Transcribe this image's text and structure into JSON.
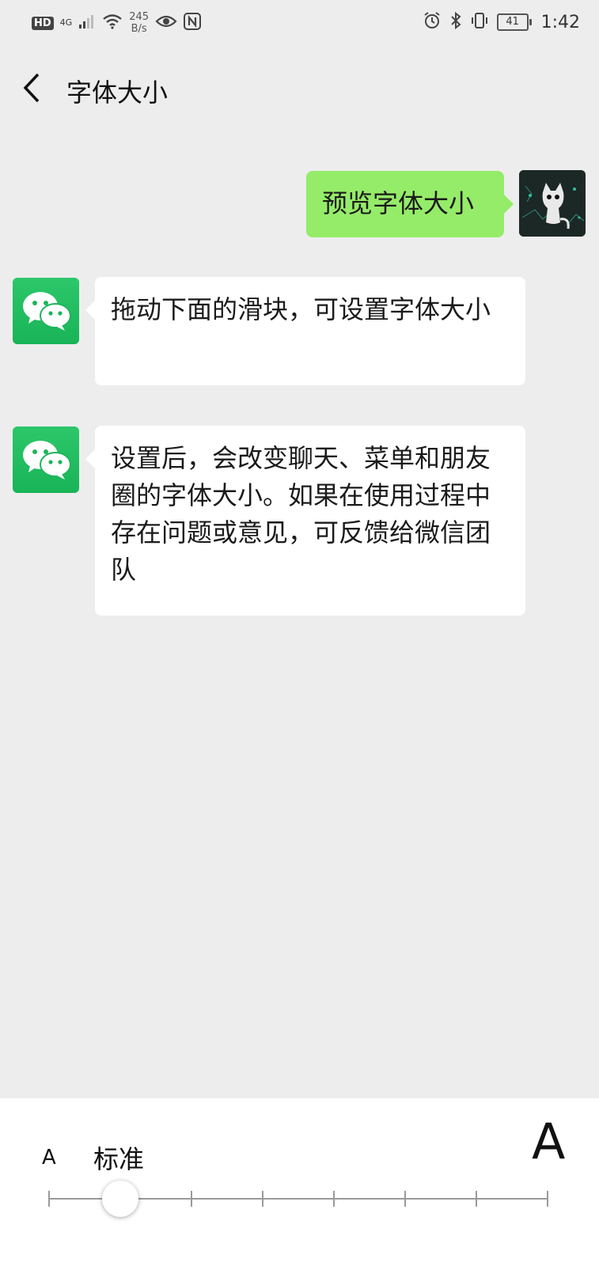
{
  "status_bar": {
    "hd": "HD",
    "network": "4G",
    "speed_value": "245",
    "speed_unit": "B/s",
    "battery": "41",
    "time": "1:42"
  },
  "header": {
    "title": "字体大小",
    "back_icon": "chevron-left-icon"
  },
  "messages": [
    {
      "side": "right",
      "text": "预览字体大小"
    },
    {
      "side": "left",
      "text": "拖动下面的滑块，可设置字体大小"
    },
    {
      "side": "left",
      "text": "设置后，会改变聊天、菜单和朋友圈的字体大小。如果在使用过程中存在问题或意见，可反馈给微信团队"
    }
  ],
  "font_size_panel": {
    "small_a": "A",
    "current_label": "标准",
    "large_a": "A",
    "slider": {
      "steps": 8,
      "selected_index": 1
    }
  },
  "colors": {
    "background": "#ededed",
    "right_bubble": "#95ec69",
    "wechat_green": "#1aad19"
  }
}
